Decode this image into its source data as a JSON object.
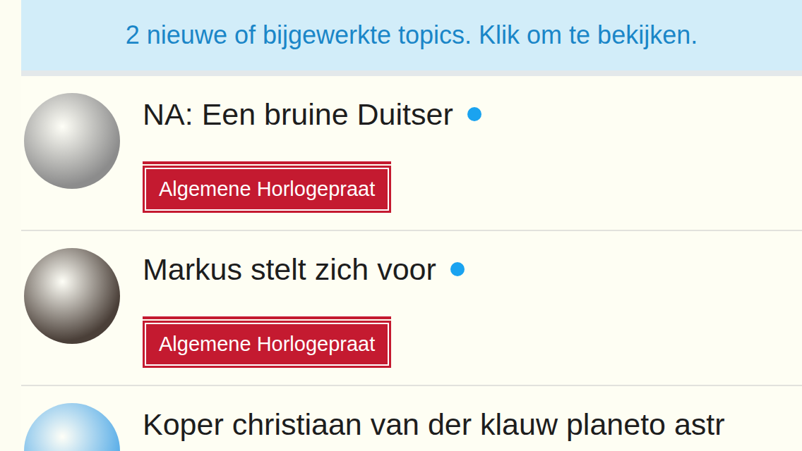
{
  "banner": {
    "text": "2 nieuwe of bijgewerkte topics. Klik om te bekijken."
  },
  "topics": [
    {
      "title": "NA: Een bruine Duitser",
      "unread": true,
      "category": "Algemene Horlogepraat",
      "color": "#c41a30",
      "avatar_color": "#8c8c8c"
    },
    {
      "title": "Markus stelt zich voor",
      "unread": true,
      "category": "Algemene Horlogepraat",
      "color": "#c41a30",
      "avatar_color": "#4a3f38"
    },
    {
      "title": "Koper christiaan van der klauw planeto astr",
      "unread": false,
      "category": "",
      "color": "#c41a30",
      "avatar_color": "#5aaee8"
    }
  ]
}
